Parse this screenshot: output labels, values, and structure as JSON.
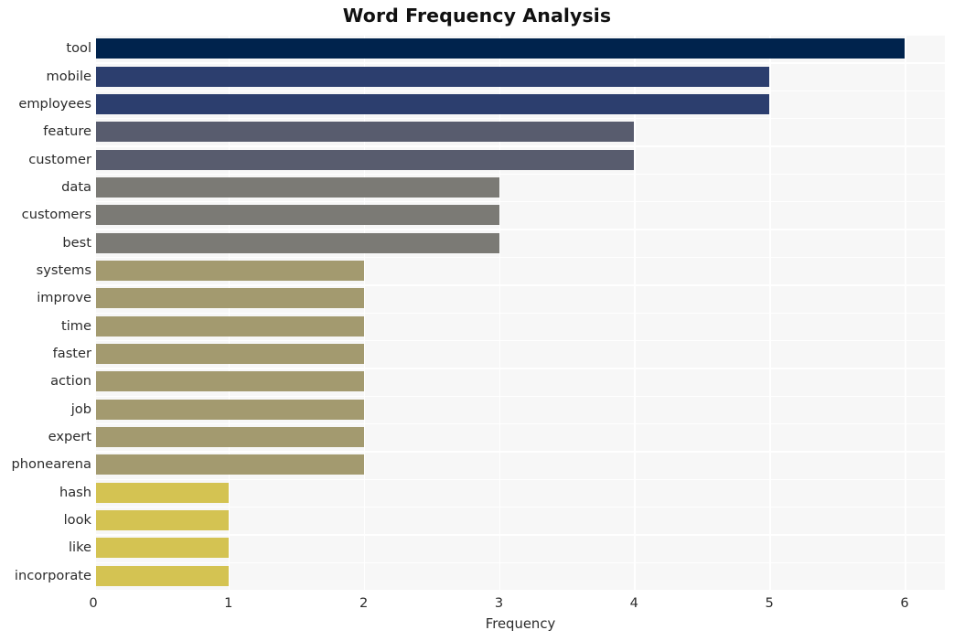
{
  "chart_data": {
    "type": "bar",
    "orientation": "horizontal",
    "title": "Word Frequency Analysis",
    "xlabel": "Frequency",
    "ylabel": "",
    "xlim": [
      0,
      6
    ],
    "xticks": [
      0,
      1,
      2,
      3,
      4,
      5,
      6
    ],
    "xtick_labels": [
      "0",
      "1",
      "2",
      "3",
      "4",
      "5",
      "6"
    ],
    "grid": true,
    "legend": null,
    "categories": [
      "tool",
      "mobile",
      "employees",
      "feature",
      "customer",
      "data",
      "customers",
      "best",
      "systems",
      "improve",
      "time",
      "faster",
      "action",
      "job",
      "expert",
      "phonearena",
      "hash",
      "look",
      "like",
      "incorporate"
    ],
    "values": [
      6,
      5,
      5,
      4,
      4,
      3,
      3,
      3,
      2,
      2,
      2,
      2,
      2,
      2,
      2,
      2,
      1,
      1,
      1,
      1
    ],
    "bar_colors": [
      "#00234d",
      "#2c3e6e",
      "#2c3e6e",
      "#585c6e",
      "#585c6e",
      "#7b7a75",
      "#7b7a75",
      "#7b7a75",
      "#a39a6f",
      "#a39a6f",
      "#a39a6f",
      "#a39a6f",
      "#a39a6f",
      "#a39a6f",
      "#a39a6f",
      "#a39a6f",
      "#d4c352",
      "#d4c352",
      "#d4c352",
      "#d4c352"
    ],
    "plot_background": "#f7f7f7",
    "grid_color": "#ffffff",
    "figure_background": "#ffffff"
  }
}
